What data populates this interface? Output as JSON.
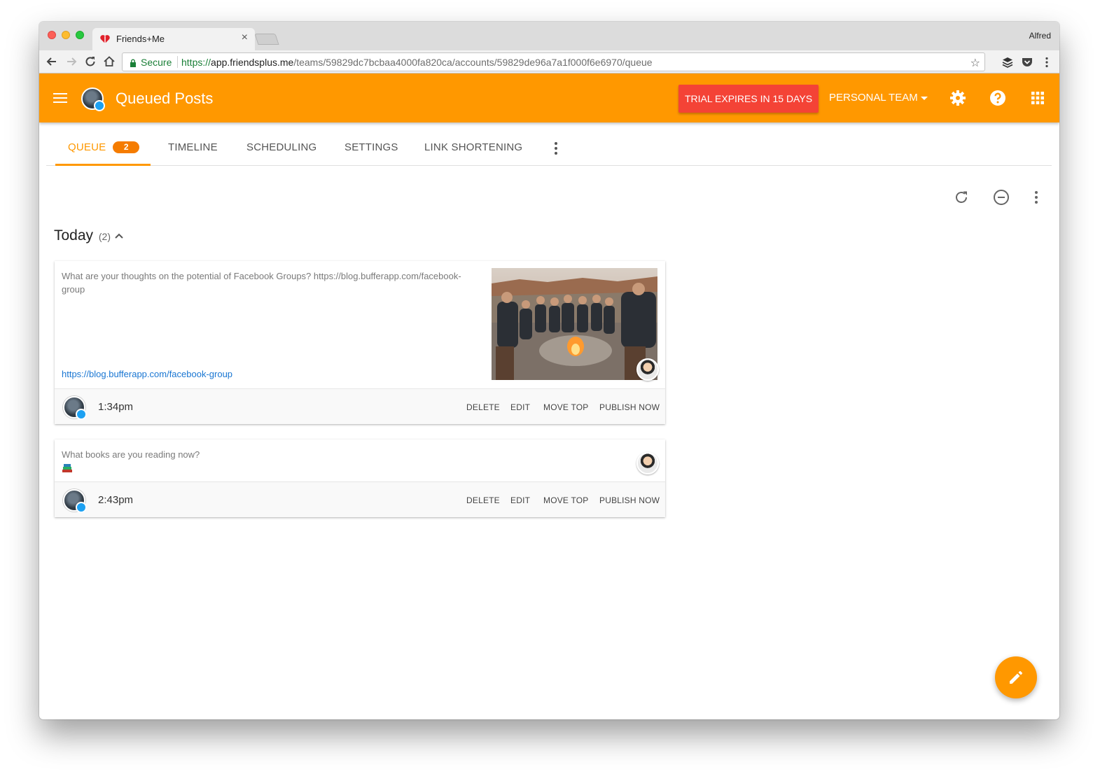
{
  "browser": {
    "tab_title": "Friends+Me",
    "profile_name": "Alfred",
    "secure_label": "Secure",
    "url_scheme": "https://",
    "url_host": "app.friendsplus.me",
    "url_path": "/teams/59829dc7bcbaa4000fa820ca/accounts/59829de96a7a1f000f6e6970/queue"
  },
  "appbar": {
    "title": "Queued Posts",
    "trial_label": "TRIAL EXPIRES IN 15 DAYS",
    "team_label": "PERSONAL TEAM"
  },
  "tabs": {
    "queue_label": "QUEUE",
    "queue_count": "2",
    "timeline_label": "TIMELINE",
    "scheduling_label": "SCHEDULING",
    "settings_label": "SETTINGS",
    "link_shortening_label": "LINK SHORTENING"
  },
  "section": {
    "title": "Today",
    "count": "(2)"
  },
  "posts": [
    {
      "text": "What are your thoughts on the potential of Facebook Groups? https://blog.bufferapp.com/facebook-group",
      "link": "https://blog.bufferapp.com/facebook-group",
      "time": "1:34pm",
      "delete_label": "DELETE",
      "edit_label": "EDIT",
      "move_top_label": "MOVE TOP",
      "publish_label": "PUBLISH NOW"
    },
    {
      "text": "What books are you reading now?",
      "time": "2:43pm",
      "delete_label": "DELETE",
      "edit_label": "EDIT",
      "move_top_label": "MOVE TOP",
      "publish_label": "PUBLISH NOW"
    }
  ],
  "colors": {
    "brand": "#ff9800",
    "trial": "#f44336",
    "badge": "#f57c00",
    "link": "#1976d2",
    "twitter": "#1da1f2"
  }
}
